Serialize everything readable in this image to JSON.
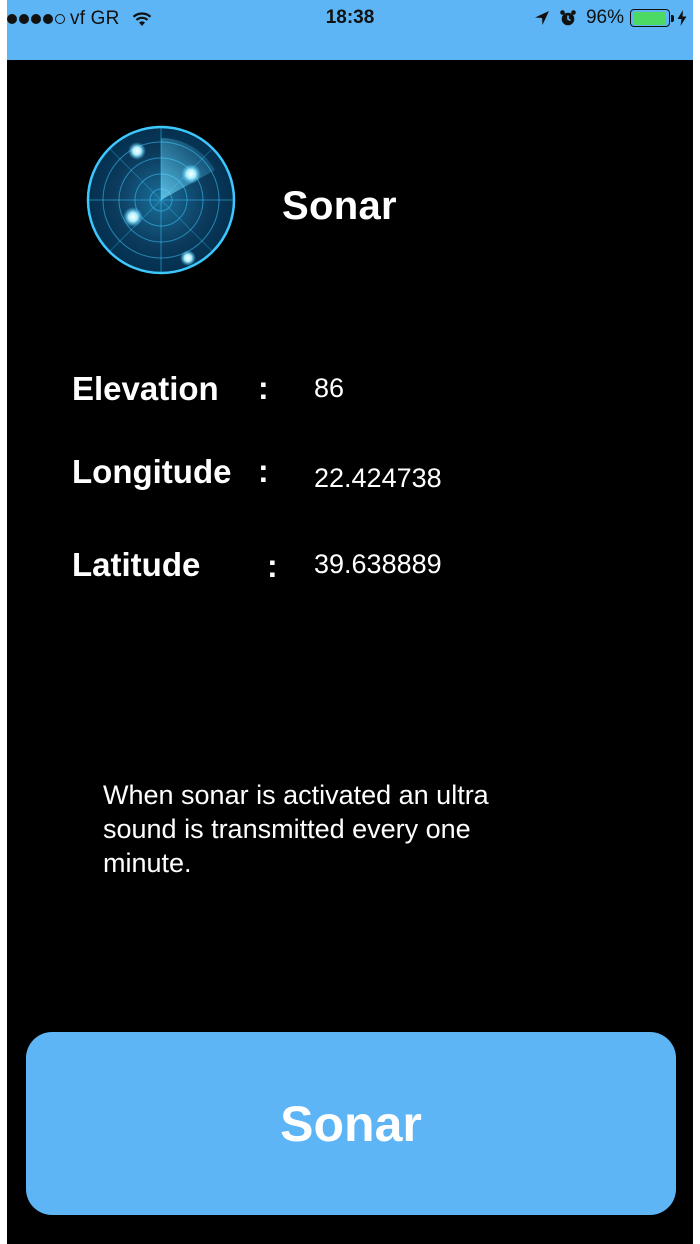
{
  "status_bar": {
    "carrier": "vf GR",
    "time": "18:38",
    "battery_percent_label": "96%",
    "battery_level": 0.96,
    "signal_bars_filled": 4,
    "signal_bars_total": 5,
    "icons": [
      "wifi-icon",
      "location-arrow-icon",
      "alarm-icon",
      "battery-icon",
      "charging-bolt-icon"
    ]
  },
  "header": {
    "title": "Sonar",
    "icon": "radar-icon"
  },
  "info": {
    "rows": [
      {
        "label": "Elevation",
        "separator": ":",
        "value": "86"
      },
      {
        "label": "Longitude",
        "separator": ":",
        "value": "22.424738"
      },
      {
        "label": "Latitude",
        "separator": ":",
        "value": "39.638889"
      }
    ]
  },
  "description": "When sonar is activated an ultra sound is transmitted every one minute.",
  "action_button": {
    "label": "Sonar"
  },
  "colors": {
    "accent": "#5db5f5",
    "background": "#000000",
    "text": "#ffffff",
    "battery_fill": "#4cd964",
    "radar_glow": "#3cc8ff"
  }
}
